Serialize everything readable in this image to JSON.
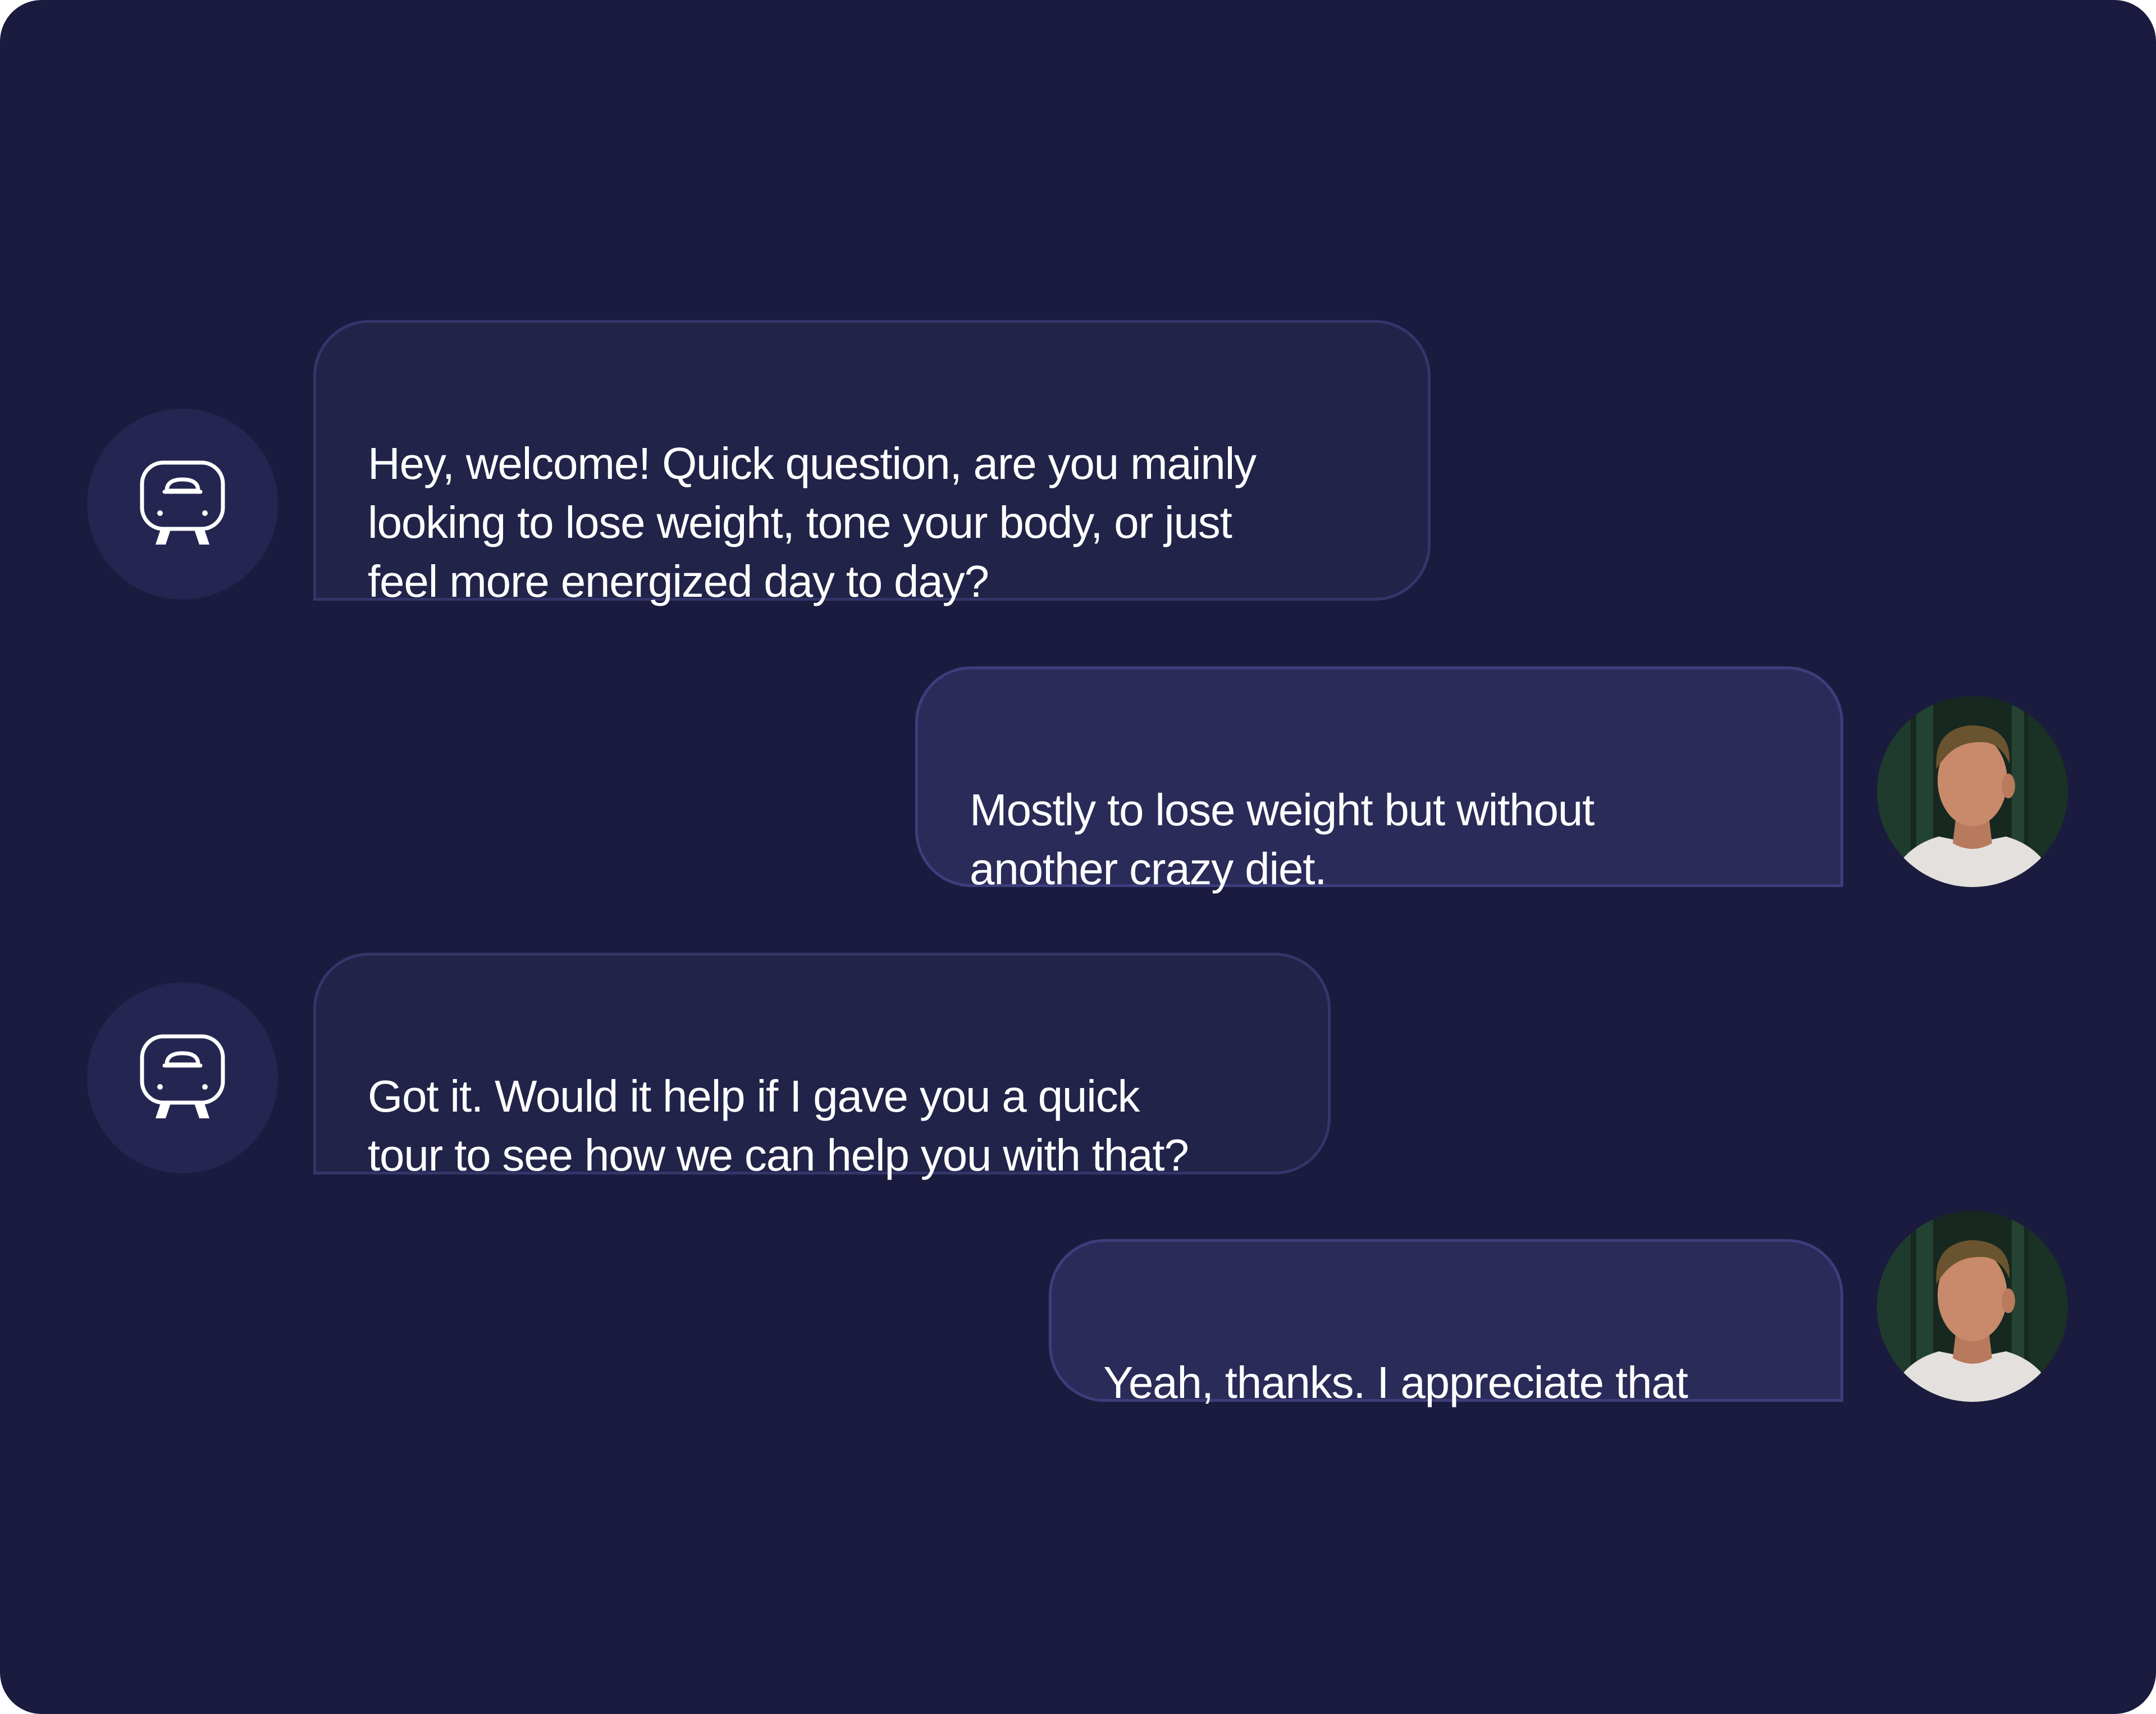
{
  "colors": {
    "background": "#1b1b3f",
    "bot_bubble": "#222348",
    "user_bubble": "#2b2b59",
    "bot_avatar": "#242651",
    "text": "#ffffff"
  },
  "messages": [
    {
      "sender": "bot",
      "avatar_icon": "robot-icon",
      "text": "Hey, welcome! Quick question, are you mainly\nlooking to lose weight, tone your body, or just\nfeel more energized day to day?"
    },
    {
      "sender": "user",
      "avatar_icon": "user-photo",
      "text": "Mostly to lose weight but without\nanother crazy diet."
    },
    {
      "sender": "bot",
      "avatar_icon": "robot-icon",
      "text": "Got it. Would it help if I gave you a quick\ntour to see how we can help you with that?"
    },
    {
      "sender": "user",
      "avatar_icon": "user-photo",
      "text": "Yeah, thanks. I appreciate that"
    }
  ]
}
